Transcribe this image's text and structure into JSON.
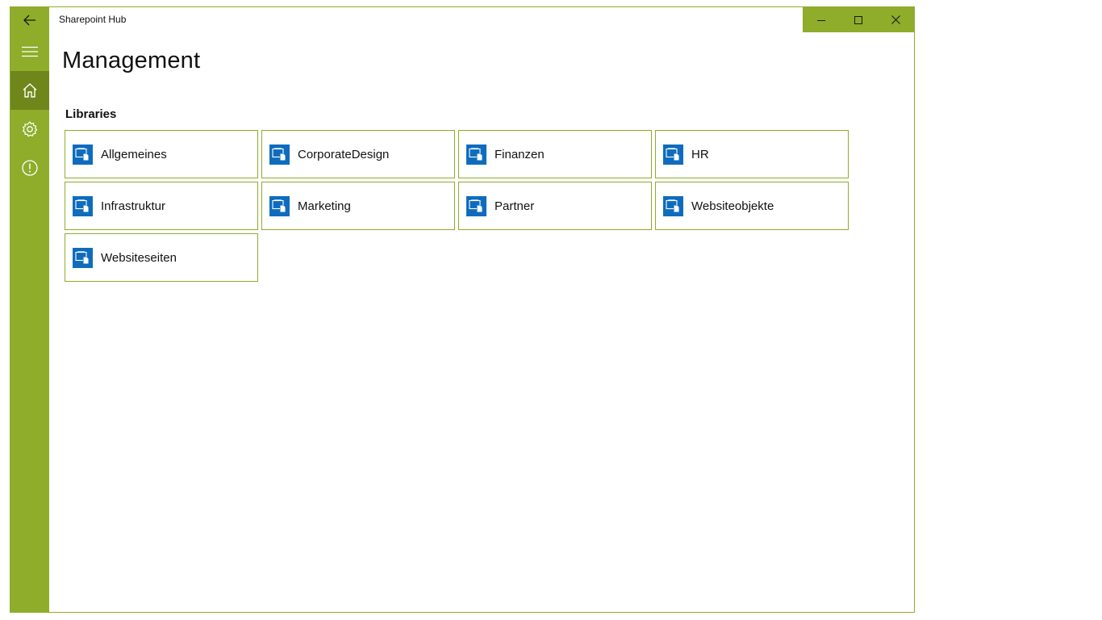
{
  "app": {
    "title": "Sharepoint Hub",
    "accent": "#8fac2a",
    "accent_selected": "#6e861a",
    "icon_color": "#0f6cbd"
  },
  "nav": {
    "items": [
      {
        "name": "back",
        "icon": "back-arrow-icon"
      },
      {
        "name": "menu",
        "icon": "hamburger-icon"
      },
      {
        "name": "home",
        "icon": "home-icon",
        "selected": true
      },
      {
        "name": "settings",
        "icon": "gear-icon"
      },
      {
        "name": "info",
        "icon": "info-icon"
      }
    ]
  },
  "window_controls": [
    "minimize",
    "maximize",
    "close"
  ],
  "page": {
    "title": "Management",
    "section_title": "Libraries"
  },
  "libraries": [
    {
      "label": "Allgemeines",
      "icon": "library-icon"
    },
    {
      "label": "CorporateDesign",
      "icon": "library-icon"
    },
    {
      "label": "Finanzen",
      "icon": "library-icon"
    },
    {
      "label": "HR",
      "icon": "library-icon"
    },
    {
      "label": "Infrastruktur",
      "icon": "library-icon"
    },
    {
      "label": "Marketing",
      "icon": "library-icon"
    },
    {
      "label": "Partner",
      "icon": "library-icon"
    },
    {
      "label": "Websiteobjekte",
      "icon": "library-icon"
    },
    {
      "label": "Websiteseiten",
      "icon": "library-icon"
    }
  ]
}
